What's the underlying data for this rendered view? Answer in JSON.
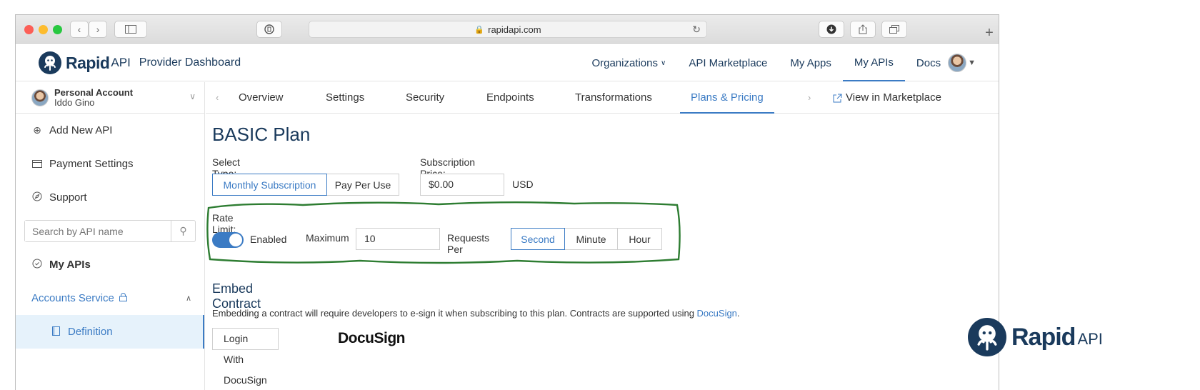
{
  "browser": {
    "url": "rapidapi.com",
    "colors": {
      "close": "#fc5f57",
      "minimize": "#fdbc2e",
      "zoom": "#28c840"
    }
  },
  "brand": {
    "name": "Rapid",
    "api": "API",
    "title": "Provider Dashboard",
    "color": "#1a3a5c"
  },
  "topnav": {
    "links": [
      "Organizations",
      "API Marketplace",
      "My Apps",
      "My APIs",
      "Docs"
    ],
    "active": "My APIs"
  },
  "sidebar": {
    "account_label": "Personal Account",
    "account_user": "Iddo Gino",
    "items": [
      "Add New API",
      "Payment Settings",
      "Support"
    ],
    "search_placeholder": "Search by API name",
    "my_apis": "My APIs",
    "service": "Accounts Service",
    "definition": "Definition"
  },
  "tabs": {
    "items": [
      "Overview",
      "Settings",
      "Security",
      "Endpoints",
      "Transformations",
      "Plans & Pricing"
    ],
    "active": "Plans & Pricing",
    "view_marketplace": "View in Marketplace"
  },
  "plan": {
    "title": "BASIC Plan",
    "select_type_label": "Select Type:",
    "type_options": [
      "Monthly Subscription",
      "Pay Per Use"
    ],
    "type_selected": "Monthly Subscription",
    "price_label": "Subscription Price:",
    "price_value": "$0.00",
    "currency": "USD",
    "rate_limit_label": "Rate Limit:",
    "enabled_label": "Enabled",
    "enabled": true,
    "maximum_label": "Maximum",
    "maximum_value": "10",
    "requests_per_label": "Requests Per",
    "period_options": [
      "Second",
      "Minute",
      "Hour"
    ],
    "period_selected": "Second"
  },
  "contract": {
    "title": "Embed Contract",
    "text": "Embedding a contract will require developers to e-sign it when subscribing to this plan. Contracts are supported using ",
    "link": "DocuSign",
    "text_end": ".",
    "button": "Login With DocuSign",
    "logo_text": "DocuSign"
  },
  "accent": "#3b7bc4",
  "highlight_color": "#2e7d32"
}
